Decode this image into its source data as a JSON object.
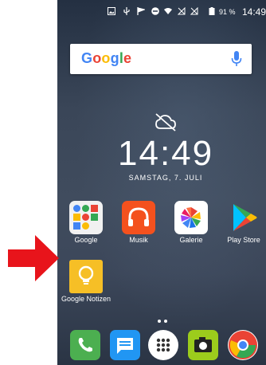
{
  "status_bar": {
    "battery_percent": "91 %",
    "time": "14:49",
    "icons": [
      "image-icon",
      "usb-icon",
      "signal-flag-icon",
      "do-not-disturb-icon",
      "wifi-icon",
      "no-sim-icon",
      "no-sim-icon",
      "battery-icon"
    ]
  },
  "search_widget": {
    "logo_text": "Google",
    "mic_icon": "mic-icon"
  },
  "clock_widget": {
    "weather_icon": "cloud-off-icon",
    "time": "14:49",
    "date": "SAMSTAG, 7. JULI"
  },
  "home_apps": [
    {
      "label": "Google",
      "icon": "google-folder-icon"
    },
    {
      "label": "Musik",
      "icon": "headphones-icon"
    },
    {
      "label": "Galerie",
      "icon": "pinwheel-icon"
    },
    {
      "label": "Play Store",
      "icon": "play-store-icon"
    },
    {
      "label": "Google Notizen",
      "icon": "lightbulb-icon"
    }
  ],
  "dock": [
    "phone-icon",
    "message-icon",
    "app-drawer-icon",
    "camera-icon",
    "chrome-icon"
  ],
  "colors": {
    "arrow": "#e8141b",
    "google_blue": "#4285f4",
    "google_red": "#ea4335",
    "google_yellow": "#fbbc05",
    "google_green": "#34a853"
  }
}
